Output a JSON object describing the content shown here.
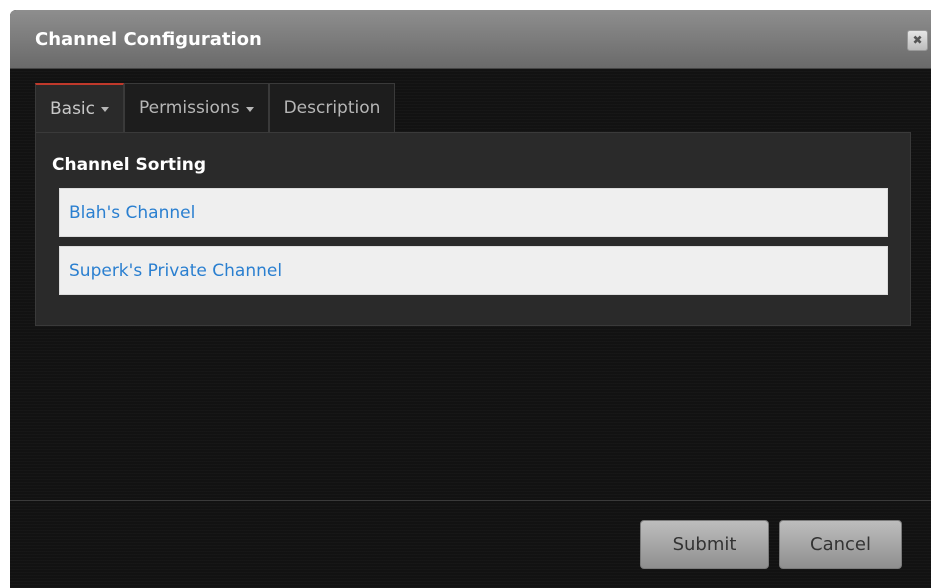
{
  "dialog": {
    "title": "Channel Configuration",
    "close_icon": "✖"
  },
  "tabs": [
    {
      "label": "Basic",
      "has_dropdown": true,
      "active": true
    },
    {
      "label": "Permissions",
      "has_dropdown": true,
      "active": false
    },
    {
      "label": "Description",
      "has_dropdown": false,
      "active": false
    }
  ],
  "panel": {
    "section_title": "Channel Sorting",
    "channels": [
      "Blah's Channel",
      "Superk's Private Channel"
    ]
  },
  "footer": {
    "submit_label": "Submit",
    "cancel_label": "Cancel"
  },
  "colors": {
    "accent_tab_border": "#c0392b",
    "link_text": "#2a7fd0"
  }
}
